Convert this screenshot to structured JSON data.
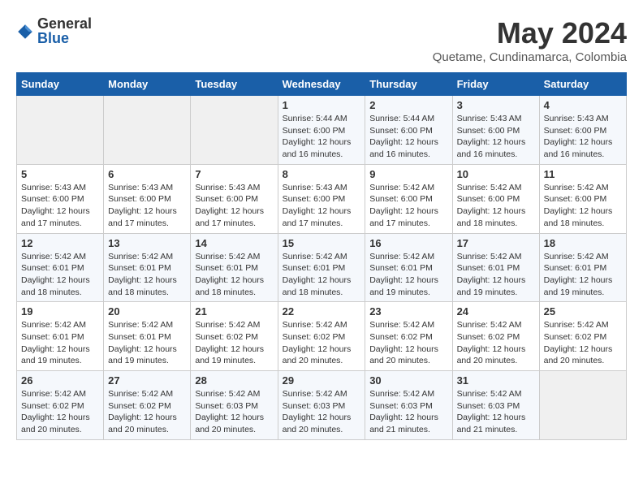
{
  "logo": {
    "general": "General",
    "blue": "Blue"
  },
  "title": {
    "month_year": "May 2024",
    "location": "Quetame, Cundinamarca, Colombia"
  },
  "weekdays": [
    "Sunday",
    "Monday",
    "Tuesday",
    "Wednesday",
    "Thursday",
    "Friday",
    "Saturday"
  ],
  "weeks": [
    [
      {
        "day": "",
        "info": ""
      },
      {
        "day": "",
        "info": ""
      },
      {
        "day": "",
        "info": ""
      },
      {
        "day": "1",
        "info": "Sunrise: 5:44 AM\nSunset: 6:00 PM\nDaylight: 12 hours\nand 16 minutes."
      },
      {
        "day": "2",
        "info": "Sunrise: 5:44 AM\nSunset: 6:00 PM\nDaylight: 12 hours\nand 16 minutes."
      },
      {
        "day": "3",
        "info": "Sunrise: 5:43 AM\nSunset: 6:00 PM\nDaylight: 12 hours\nand 16 minutes."
      },
      {
        "day": "4",
        "info": "Sunrise: 5:43 AM\nSunset: 6:00 PM\nDaylight: 12 hours\nand 16 minutes."
      }
    ],
    [
      {
        "day": "5",
        "info": "Sunrise: 5:43 AM\nSunset: 6:00 PM\nDaylight: 12 hours\nand 17 minutes."
      },
      {
        "day": "6",
        "info": "Sunrise: 5:43 AM\nSunset: 6:00 PM\nDaylight: 12 hours\nand 17 minutes."
      },
      {
        "day": "7",
        "info": "Sunrise: 5:43 AM\nSunset: 6:00 PM\nDaylight: 12 hours\nand 17 minutes."
      },
      {
        "day": "8",
        "info": "Sunrise: 5:43 AM\nSunset: 6:00 PM\nDaylight: 12 hours\nand 17 minutes."
      },
      {
        "day": "9",
        "info": "Sunrise: 5:42 AM\nSunset: 6:00 PM\nDaylight: 12 hours\nand 17 minutes."
      },
      {
        "day": "10",
        "info": "Sunrise: 5:42 AM\nSunset: 6:00 PM\nDaylight: 12 hours\nand 18 minutes."
      },
      {
        "day": "11",
        "info": "Sunrise: 5:42 AM\nSunset: 6:00 PM\nDaylight: 12 hours\nand 18 minutes."
      }
    ],
    [
      {
        "day": "12",
        "info": "Sunrise: 5:42 AM\nSunset: 6:01 PM\nDaylight: 12 hours\nand 18 minutes."
      },
      {
        "day": "13",
        "info": "Sunrise: 5:42 AM\nSunset: 6:01 PM\nDaylight: 12 hours\nand 18 minutes."
      },
      {
        "day": "14",
        "info": "Sunrise: 5:42 AM\nSunset: 6:01 PM\nDaylight: 12 hours\nand 18 minutes."
      },
      {
        "day": "15",
        "info": "Sunrise: 5:42 AM\nSunset: 6:01 PM\nDaylight: 12 hours\nand 18 minutes."
      },
      {
        "day": "16",
        "info": "Sunrise: 5:42 AM\nSunset: 6:01 PM\nDaylight: 12 hours\nand 19 minutes."
      },
      {
        "day": "17",
        "info": "Sunrise: 5:42 AM\nSunset: 6:01 PM\nDaylight: 12 hours\nand 19 minutes."
      },
      {
        "day": "18",
        "info": "Sunrise: 5:42 AM\nSunset: 6:01 PM\nDaylight: 12 hours\nand 19 minutes."
      }
    ],
    [
      {
        "day": "19",
        "info": "Sunrise: 5:42 AM\nSunset: 6:01 PM\nDaylight: 12 hours\nand 19 minutes."
      },
      {
        "day": "20",
        "info": "Sunrise: 5:42 AM\nSunset: 6:01 PM\nDaylight: 12 hours\nand 19 minutes."
      },
      {
        "day": "21",
        "info": "Sunrise: 5:42 AM\nSunset: 6:02 PM\nDaylight: 12 hours\nand 19 minutes."
      },
      {
        "day": "22",
        "info": "Sunrise: 5:42 AM\nSunset: 6:02 PM\nDaylight: 12 hours\nand 20 minutes."
      },
      {
        "day": "23",
        "info": "Sunrise: 5:42 AM\nSunset: 6:02 PM\nDaylight: 12 hours\nand 20 minutes."
      },
      {
        "day": "24",
        "info": "Sunrise: 5:42 AM\nSunset: 6:02 PM\nDaylight: 12 hours\nand 20 minutes."
      },
      {
        "day": "25",
        "info": "Sunrise: 5:42 AM\nSunset: 6:02 PM\nDaylight: 12 hours\nand 20 minutes."
      }
    ],
    [
      {
        "day": "26",
        "info": "Sunrise: 5:42 AM\nSunset: 6:02 PM\nDaylight: 12 hours\nand 20 minutes."
      },
      {
        "day": "27",
        "info": "Sunrise: 5:42 AM\nSunset: 6:02 PM\nDaylight: 12 hours\nand 20 minutes."
      },
      {
        "day": "28",
        "info": "Sunrise: 5:42 AM\nSunset: 6:03 PM\nDaylight: 12 hours\nand 20 minutes."
      },
      {
        "day": "29",
        "info": "Sunrise: 5:42 AM\nSunset: 6:03 PM\nDaylight: 12 hours\nand 20 minutes."
      },
      {
        "day": "30",
        "info": "Sunrise: 5:42 AM\nSunset: 6:03 PM\nDaylight: 12 hours\nand 21 minutes."
      },
      {
        "day": "31",
        "info": "Sunrise: 5:42 AM\nSunset: 6:03 PM\nDaylight: 12 hours\nand 21 minutes."
      },
      {
        "day": "",
        "info": ""
      }
    ]
  ]
}
